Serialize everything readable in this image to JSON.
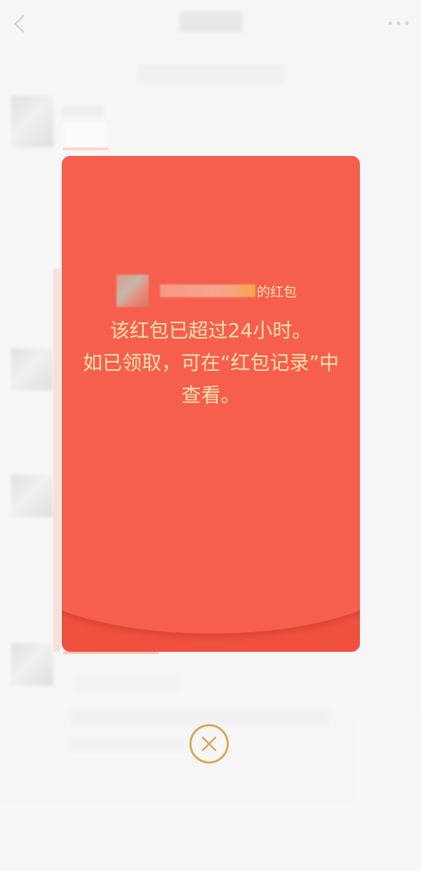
{
  "nav": {
    "back_icon": "chevron-left-icon",
    "more_icon": "more-horizontal-icon"
  },
  "red_packet": {
    "sender_suffix": "的红包",
    "message": "该红包已超过24小时。\n如已领取，可在“红包记录”中查看。",
    "colors": {
      "card_top": "#f65f4e",
      "card_bottom": "#f0513f",
      "text": "#fbe0ad"
    }
  },
  "close_button": {
    "icon": "close-circle-icon",
    "color": "#d4a956"
  }
}
